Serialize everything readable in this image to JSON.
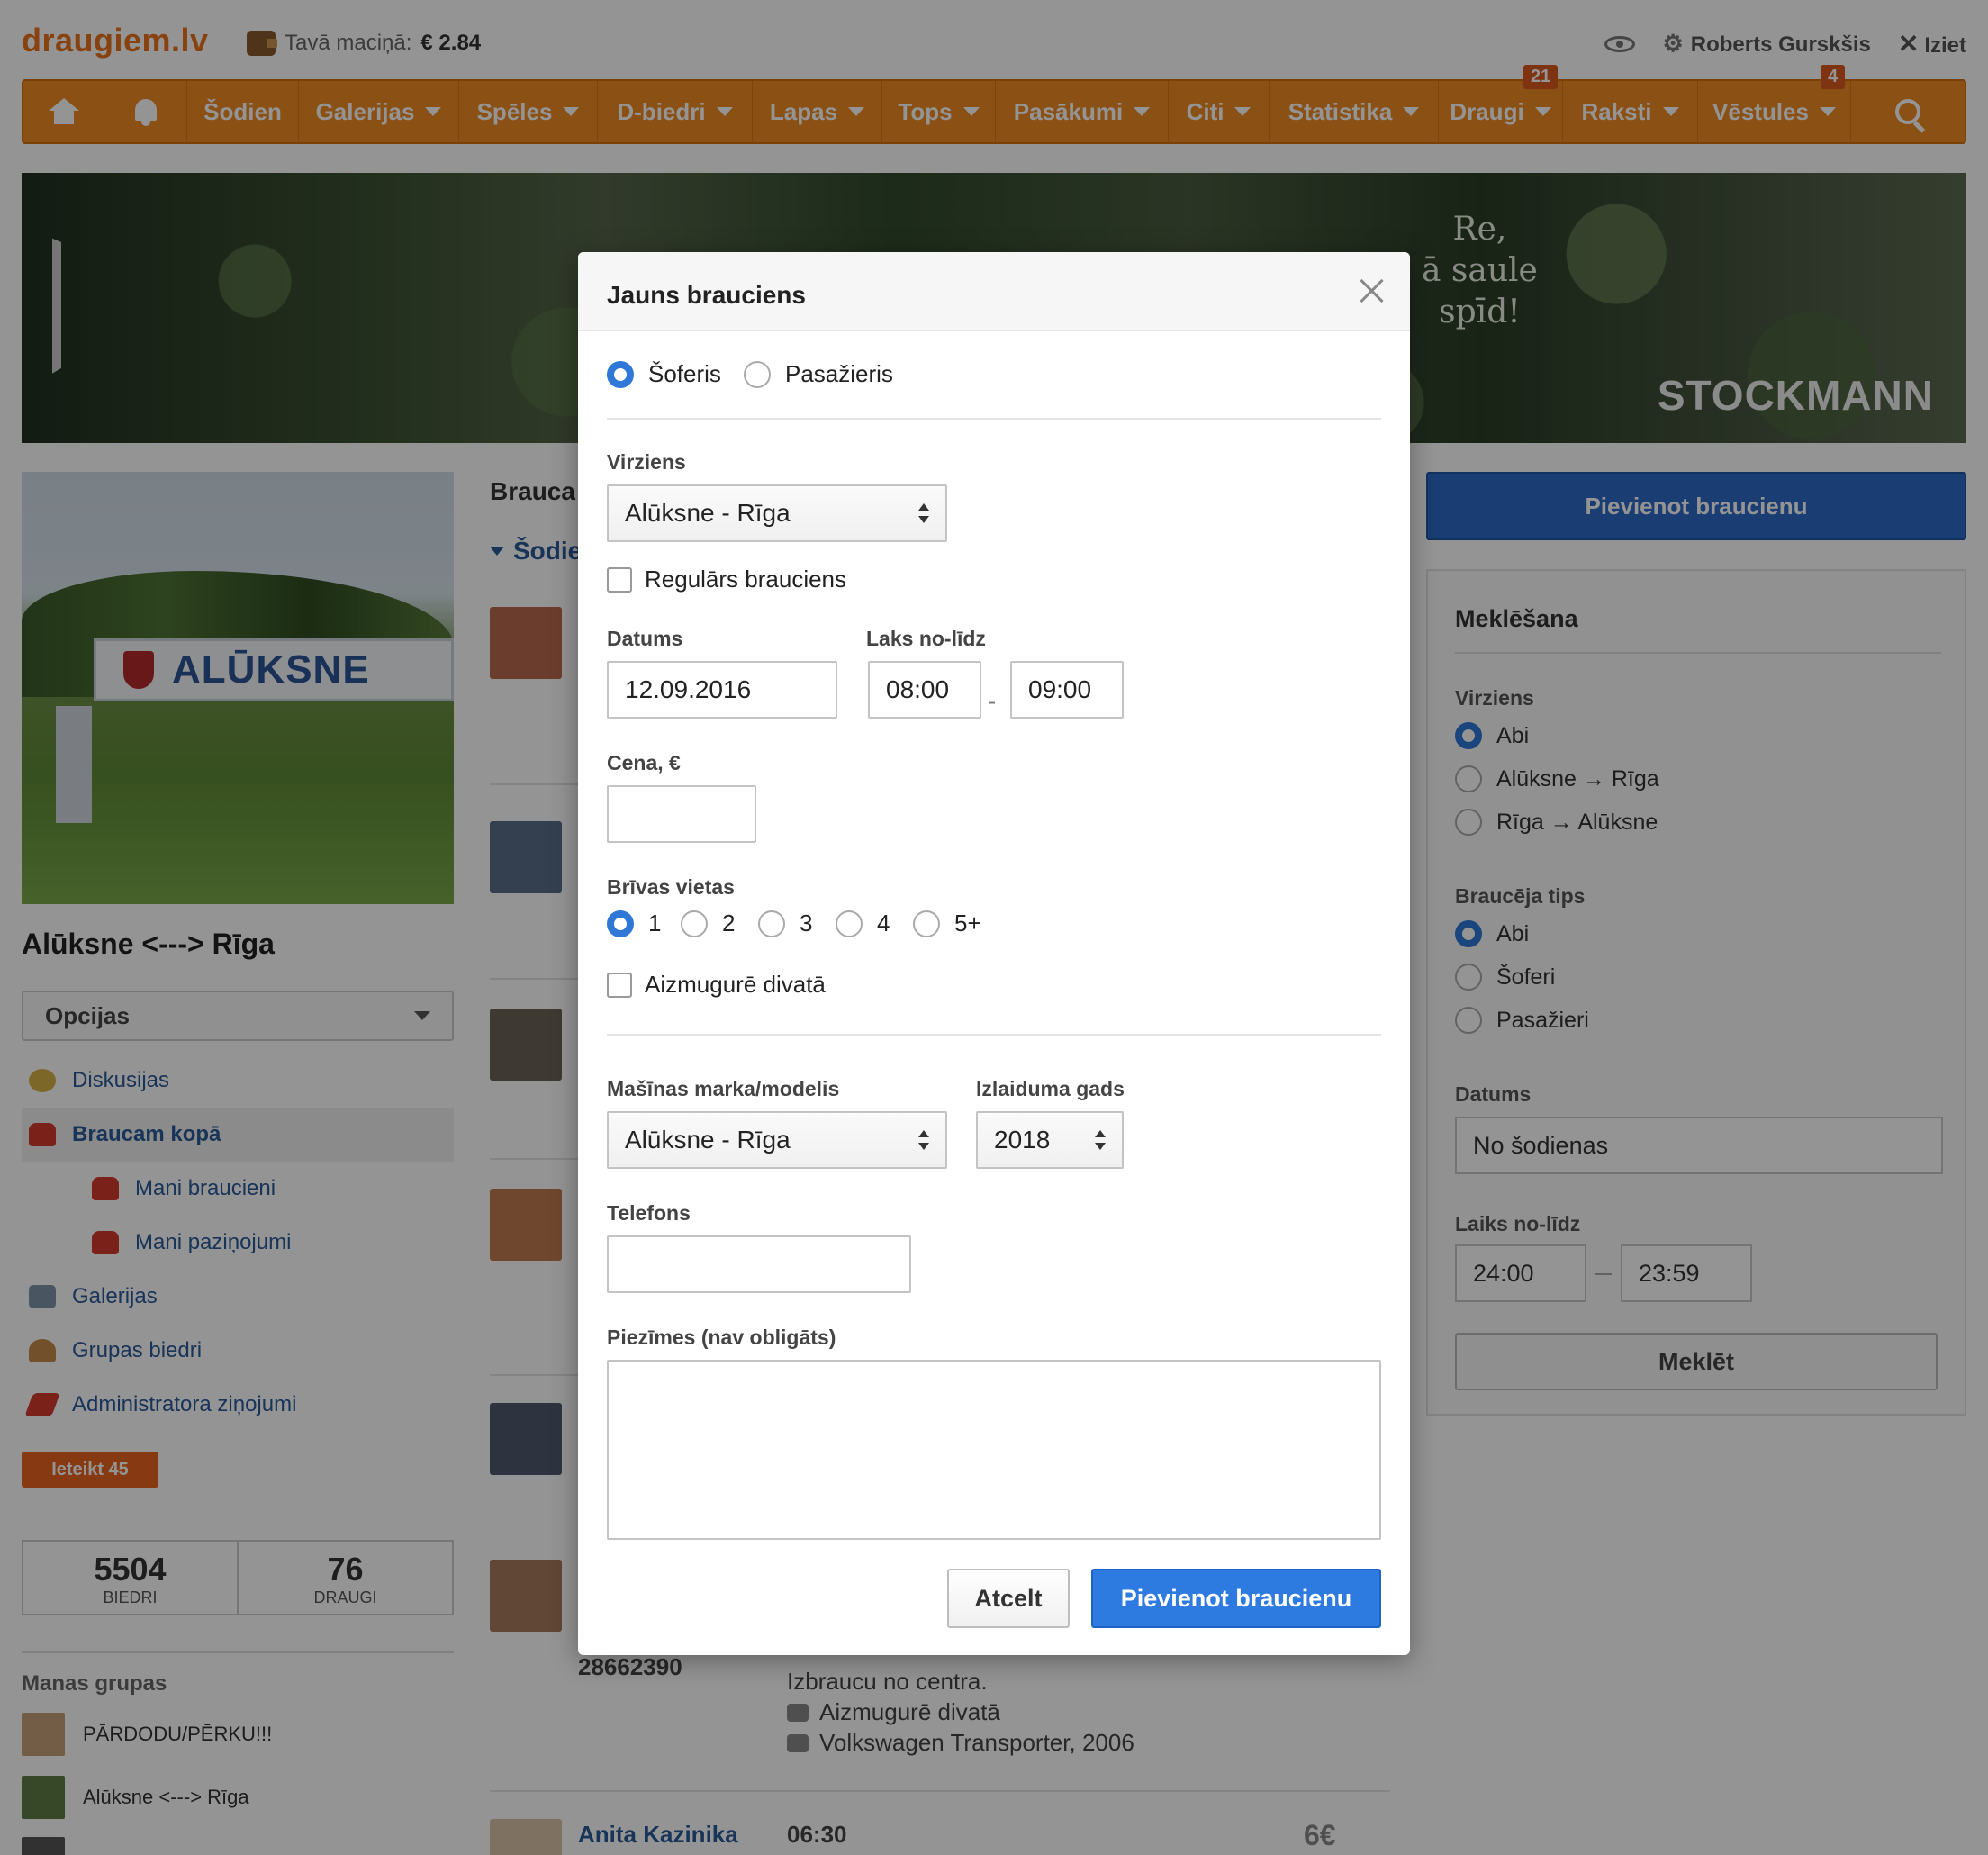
{
  "header": {
    "logo": "draugiem.lv",
    "wallet_label": "Tavā maciņā:",
    "wallet_amount": "€ 2.84",
    "user_name": "Roberts Gurskšis",
    "logout": "Iziet"
  },
  "nav": {
    "items": [
      {
        "label": "Šodien"
      },
      {
        "label": "Galerijas"
      },
      {
        "label": "Spēles"
      },
      {
        "label": "D-biedri"
      },
      {
        "label": "Lapas"
      },
      {
        "label": "Tops"
      },
      {
        "label": "Pasākumi"
      },
      {
        "label": "Citi"
      },
      {
        "label": "Statistika"
      },
      {
        "label": "Draugi",
        "badge": "21"
      },
      {
        "label": "Raksti"
      },
      {
        "label": "Vēstules",
        "badge": "4"
      }
    ]
  },
  "banner": {
    "slogan_1": "Re,",
    "slogan_2": "ā saule",
    "slogan_3": "spīd!",
    "brand": "STOCKMANN"
  },
  "left": {
    "photo_sign": "ALŪKSNE",
    "group_title": "Alūksne <---> Rīga",
    "options_label": "Opcijas",
    "menu": [
      {
        "label": "Diskusijas"
      },
      {
        "label": "Braucam kopā"
      },
      {
        "label": "Mani braucieni"
      },
      {
        "label": "Mani paziņojumi"
      },
      {
        "label": "Galerijas"
      },
      {
        "label": "Grupas biedri"
      },
      {
        "label": "Administratora ziņojumi"
      }
    ],
    "join_label": "Ieteikt 45",
    "stats": [
      {
        "value": "5504",
        "label": "BIEDRI"
      },
      {
        "value": "76",
        "label": "DRAUGI"
      }
    ],
    "my_groups_title": "Manas grupas",
    "my_groups": [
      {
        "label": "PĀRDODU/PĒRKU!!!"
      },
      {
        "label": "Alūksne <---> Rīga"
      }
    ]
  },
  "middle": {
    "title": "Brauca",
    "today": "Šodie",
    "phone": "28662390",
    "note_1": "Izbraucu no centra.",
    "note_2": "Aizmugurē divatā",
    "note_3": "Volkswagen Transporter, 2006",
    "next_name": "Anita Kazinika",
    "next_time": "06:30",
    "next_price": "6€"
  },
  "right": {
    "add_button": "Pievienot braucienu",
    "search_title": "Meklēšana",
    "direction_label": "Virziens",
    "direction_options": [
      "Abi",
      "Alūksne → Rīga",
      "Rīga → Alūksne"
    ],
    "driver_type_label": "Braucēja tips",
    "driver_type_options": [
      "Abi",
      "Šoferi",
      "Pasažieri"
    ],
    "date_label": "Datums",
    "date_value": "No šodienas",
    "time_label": "Laiks no-līdz",
    "time_from": "24:00",
    "time_to": "23:59",
    "search_button": "Meklēt"
  },
  "modal": {
    "title": "Jauns brauciens",
    "role_options": [
      "Šoferis",
      "Pasažieris"
    ],
    "direction_label": "Virziens",
    "direction_value": "Alūksne - Rīga",
    "regular_label": "Regulārs brauciens",
    "date_label": "Datums",
    "date_value": "12.09.2016",
    "time_label": "Laks no-līdz",
    "time_from": "08:00",
    "time_sep": "-",
    "time_to": "09:00",
    "price_label": "Cena, €",
    "price_value": "",
    "seats_label": "Brīvas vietas",
    "seats_options": [
      "1",
      "2",
      "3",
      "4",
      "5+"
    ],
    "backseat_label": "Aizmugurē divatā",
    "car_label": "Mašīnas marka/modelis",
    "car_value": "Alūksne - Rīga",
    "year_label": "Izlaiduma gads",
    "year_value": "2018",
    "phone_label": "Telefons",
    "phone_value": "",
    "notes_label": "Piezīmes (nav obligāts)",
    "cancel_button": "Atcelt",
    "submit_button": "Pievienot braucienu"
  },
  "colors": {
    "brand_orange": "#f08a24",
    "primary_blue": "#2d7ae0",
    "link_blue": "#2a5a9a"
  }
}
